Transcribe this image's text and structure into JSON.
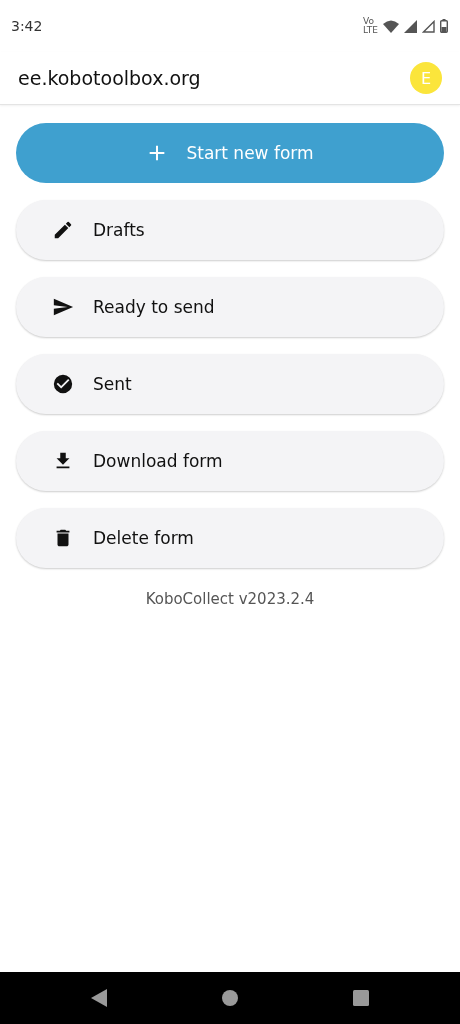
{
  "status_bar": {
    "time": "3:42",
    "network_label": [
      "Vo",
      "LTE"
    ]
  },
  "app_bar": {
    "title": "ee.kobotoolbox.org",
    "avatar_letter": "E"
  },
  "actions": [
    {
      "kind": "add",
      "label": "Start new form",
      "primary": true
    },
    {
      "kind": "edit",
      "label": "Drafts",
      "primary": false
    },
    {
      "kind": "send",
      "label": "Ready to send",
      "primary": false
    },
    {
      "kind": "check",
      "label": "Sent",
      "primary": false
    },
    {
      "kind": "download",
      "label": "Download form",
      "primary": false
    },
    {
      "kind": "delete",
      "label": "Delete form",
      "primary": false
    }
  ],
  "version": "KoboCollect v2023.2.4"
}
